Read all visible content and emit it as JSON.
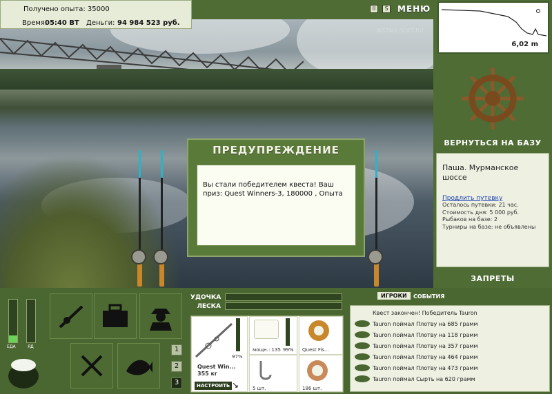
{
  "stats": {
    "exp_label": "Получено опыта: 35000",
    "time_label": "Время:",
    "time_value": "05:40 ВТ",
    "money_label": "Деньги:",
    "money_value": "94 984 523 руб."
  },
  "top": {
    "pause_icon": "II",
    "sound_icon": "S",
    "menu_label": "МЕНЮ",
    "watermark": "INSTALL-SOFT.RU"
  },
  "depth": {
    "value": "6,02 m"
  },
  "nav": {
    "back_label": "ВЕРНУТЬСЯ НА БАЗУ",
    "bans_label": "ЗАПРЕТЫ"
  },
  "info": {
    "place": "Паша. Мурманское шоссе",
    "extend_link": "Продлить путевку",
    "lines": [
      "Осталось путевки: 21 час.",
      "Стоимость дня: 5 000 руб.",
      "Рыбаков на базе: 2",
      "Турниры на базе: не объявлены"
    ]
  },
  "modal": {
    "title": "ПРЕДУПРЕЖДЕНИЕ",
    "message": "Вы стали победителем квеста! Ваш приз: Quest Winners-3, 180000 , Опыта"
  },
  "bottom": {
    "food_label": "ЕДА",
    "poison_label": "ЯД",
    "rod_label": "УДОЧКА",
    "line_label": "ЛЕСКА",
    "rod_panel": {
      "name": "Quest Win...",
      "weight": "355 кг",
      "percent": "97%",
      "setup_button": "НАСТРОИТЬ"
    },
    "slots": [
      {
        "caption": "мощн.: 135",
        "percent": "99%"
      },
      {
        "caption": "Quest Fis..."
      },
      {
        "caption": "5 шт."
      },
      {
        "caption": "186 шт."
      }
    ],
    "num_buttons": [
      "1",
      "2",
      "3"
    ]
  },
  "log": {
    "tabs": [
      "ИГРОКИ",
      "СОБЫТИЯ"
    ],
    "header": "Квест закончен! Победитель Tauron",
    "entries": [
      "Tauron поймал Плотву на 685 грамм",
      "Tauron поймал Плотву на 118 грамм",
      "Tauron поймал Плотву на 357 грамм",
      "Tauron поймал Плотву на 464 грамм",
      "Tauron поймал Плотву на 473 грамм",
      "Tauron поймал Сырть на 620 грамм"
    ]
  },
  "colors": {
    "panel": "#4f6c35",
    "accent": "#29b4c9",
    "text_light": "#ffffff"
  }
}
